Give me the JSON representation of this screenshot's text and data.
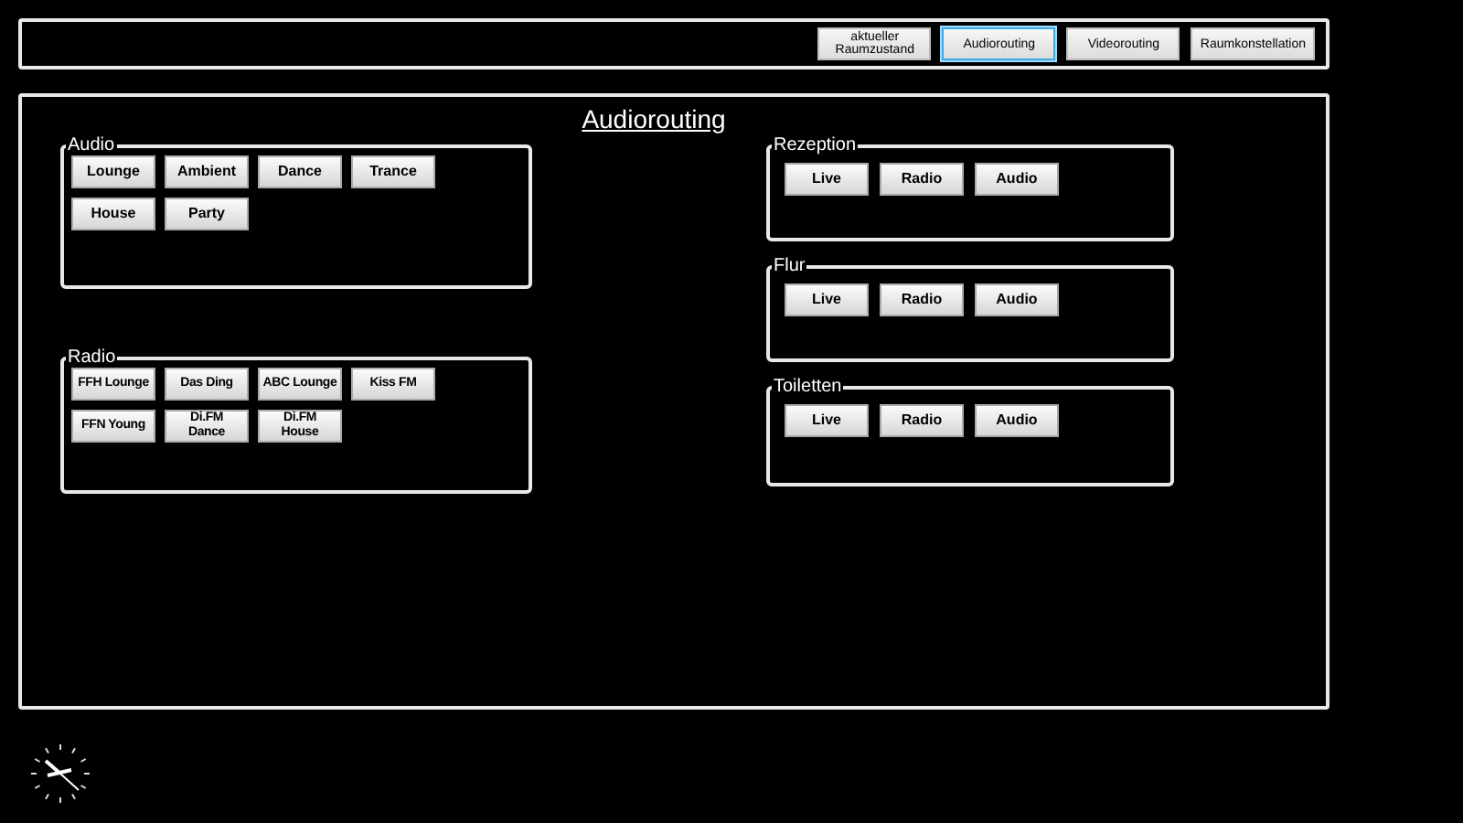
{
  "nav": [
    {
      "label": "aktueller Raumzustand",
      "selected": false
    },
    {
      "label": "Audiorouting",
      "selected": true
    },
    {
      "label": "Videorouting",
      "selected": false
    },
    {
      "label": "Raumkonstellation",
      "selected": false
    }
  ],
  "title": "Audiorouting",
  "sources": [
    {
      "title": "Audio",
      "buttons": [
        "Lounge",
        "Ambient",
        "Dance",
        "Trance",
        "House",
        "Party"
      ]
    },
    {
      "title": "Radio",
      "buttons": [
        "FFH Lounge",
        "Das Ding",
        "ABC Lounge",
        "Kiss FM",
        "FFN Young",
        "Di.FM\nDance",
        "Di.FM\nHouse"
      ]
    }
  ],
  "zones": [
    {
      "title": "Rezeption",
      "buttons": [
        "Live",
        "Radio",
        "Audio"
      ]
    },
    {
      "title": "Flur",
      "buttons": [
        "Live",
        "Radio",
        "Audio"
      ]
    },
    {
      "title": "Toiletten",
      "buttons": [
        "Live",
        "Radio",
        "Audio"
      ]
    }
  ]
}
